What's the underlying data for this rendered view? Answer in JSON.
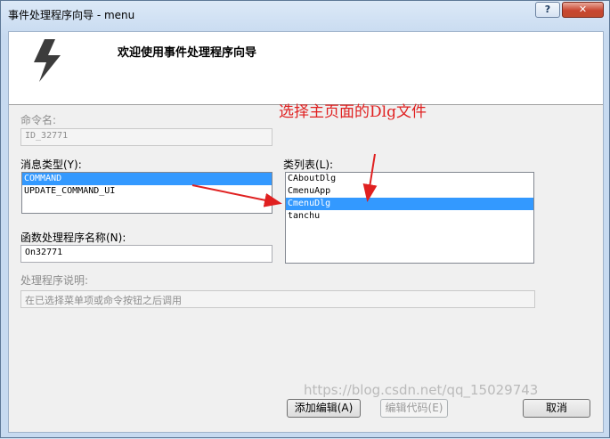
{
  "window": {
    "title": "事件处理程序向导 - menu",
    "help_label": "?",
    "close_label": "✕"
  },
  "header": {
    "title": "欢迎使用事件处理程序向导",
    "icon": "lightning-bolt-icon"
  },
  "command_name": {
    "label": "命令名:",
    "value": "ID_32771"
  },
  "message_type": {
    "label": "消息类型(Y):",
    "items": [
      "COMMAND",
      "UPDATE_COMMAND_UI"
    ],
    "selected": "COMMAND"
  },
  "class_list": {
    "label": "类列表(L):",
    "items": [
      "CAboutDlg",
      "CmenuApp",
      "CmenuDlg",
      "tanchu"
    ],
    "selected": "CmenuDlg"
  },
  "function_name": {
    "label": "函数处理程序名称(N):",
    "value": "On32771"
  },
  "handler_description": {
    "label": "处理程序说明:",
    "value": "在已选择菜单项或命令按钮之后调用"
  },
  "annotation": "选择主页面的Dlg文件",
  "buttons": {
    "add_edit": "添加编辑(A)",
    "edit_code": "编辑代码(E)",
    "cancel": "取消"
  },
  "watermark": "https://blog.csdn.net/qq_15029743",
  "colors": {
    "selection": "#3399ff",
    "annotation": "#e02020"
  }
}
